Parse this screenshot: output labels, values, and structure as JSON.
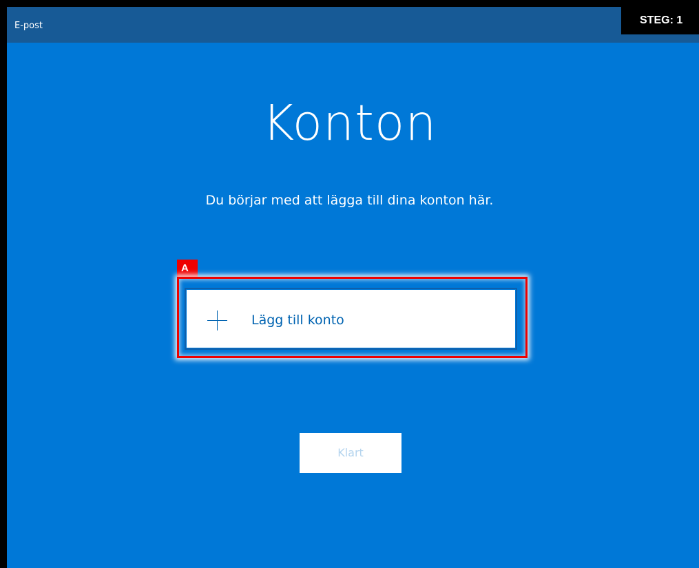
{
  "window": {
    "title": "E-post"
  },
  "overlay": {
    "step_label": "STEG: 1",
    "annotation_tag": "A"
  },
  "main": {
    "heading": "Konton",
    "subtitle": "Du börjar med att lägga till dina konton här.",
    "add_account": {
      "icon": "plus-icon",
      "label": "Lägg till konto"
    },
    "done_button": {
      "label": "Klart",
      "enabled": false
    }
  },
  "colors": {
    "background": "#0078d7",
    "titlebar": "#175a96",
    "accent_text": "#0063b1",
    "annotation": "#ee0000"
  }
}
